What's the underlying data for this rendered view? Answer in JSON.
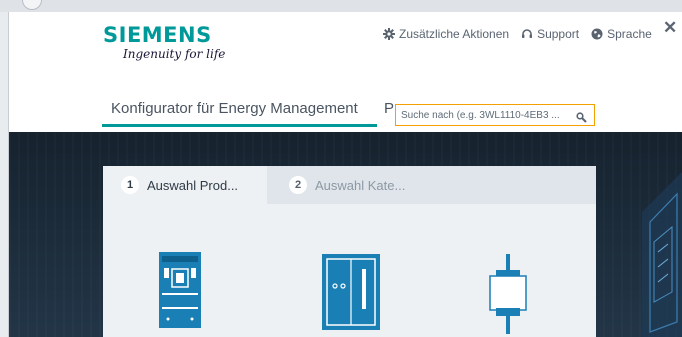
{
  "brand": {
    "name": "SIEMENS",
    "tagline": "Ingenuity for life",
    "color": "#009999"
  },
  "header": {
    "actions": [
      {
        "label": "Zusätzliche Aktionen",
        "icon": "gear-icon"
      },
      {
        "label": "Support",
        "icon": "headset-icon"
      },
      {
        "label": "Sprache",
        "icon": "globe-icon"
      }
    ],
    "close_label": "✕"
  },
  "nav": {
    "title": "Konfigurator für Energy Management",
    "next_partial": "P"
  },
  "search": {
    "placeholder": "Suche nach (e.g. 3WL1110-4EB3 ...",
    "border_color": "#f4a000",
    "icon": "search-icon"
  },
  "steps": [
    {
      "number": "1",
      "label": "Auswahl Prod...",
      "active": true
    },
    {
      "number": "2",
      "label": "Auswahl Kate...",
      "active": false
    }
  ],
  "products": [
    {
      "icon": "circuit-breaker-icon"
    },
    {
      "icon": "switch-cabinet-icon"
    },
    {
      "icon": "fuse-switch-icon"
    }
  ],
  "colors": {
    "hero_bg": "#1b2a38",
    "icon_blue": "#1a7fb5"
  }
}
